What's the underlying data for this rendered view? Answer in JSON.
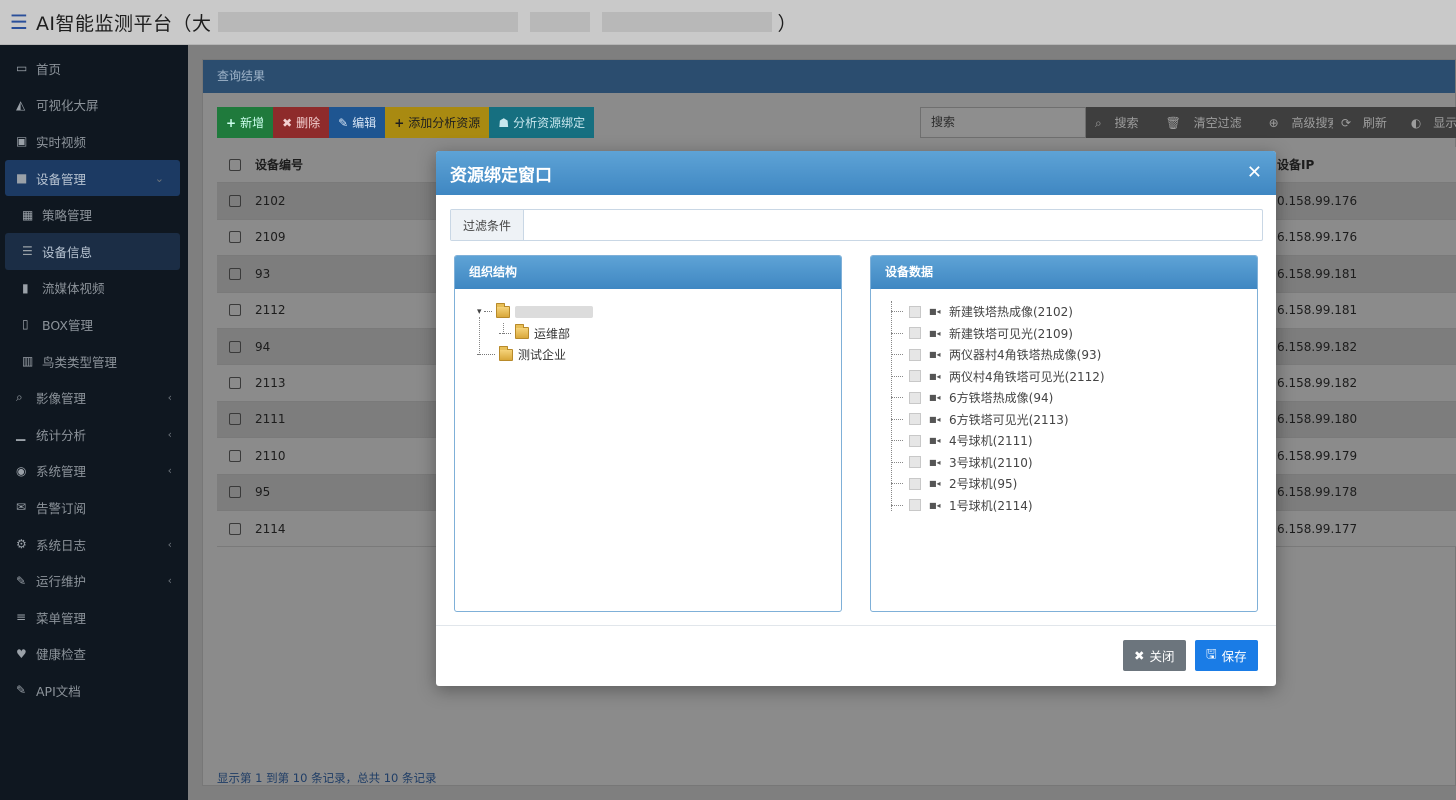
{
  "header": {
    "title": "AI智能监测平台（大",
    "title_suffix": "）"
  },
  "sidebar": {
    "items": [
      {
        "icon": "monitor-icon",
        "glyph": "▭",
        "label": "首页"
      },
      {
        "icon": "area-chart-icon",
        "glyph": "◭",
        "label": "可视化大屏"
      },
      {
        "icon": "film-icon",
        "glyph": "▣",
        "label": "实时视频"
      },
      {
        "icon": "video-camera-icon",
        "glyph": "■",
        "label": "设备管理",
        "caret": "⌄"
      },
      {
        "icon": "grid-icon",
        "glyph": "▦",
        "label": "策略管理"
      },
      {
        "icon": "list-icon",
        "glyph": "☰",
        "label": "设备信息"
      },
      {
        "icon": "stream-icon",
        "glyph": "▮",
        "label": "流媒体视频"
      },
      {
        "icon": "box-icon",
        "glyph": "▯",
        "label": "BOX管理"
      },
      {
        "icon": "building-icon",
        "glyph": "▥",
        "label": "鸟类类型管理"
      },
      {
        "icon": "search-icon",
        "glyph": "⌕",
        "label": "影像管理",
        "caret": "‹"
      },
      {
        "icon": "bar-chart-icon",
        "glyph": "▁",
        "label": "统计分析",
        "caret": "‹"
      },
      {
        "icon": "user-circle-icon",
        "glyph": "◉",
        "label": "系统管理",
        "caret": "‹"
      },
      {
        "icon": "envelope-icon",
        "glyph": "✉",
        "label": "告警订阅"
      },
      {
        "icon": "cogs-icon",
        "glyph": "⚙",
        "label": "系统日志",
        "caret": "‹"
      },
      {
        "icon": "wrench-icon",
        "glyph": "✎",
        "label": "运行维护",
        "caret": "‹"
      },
      {
        "icon": "menu-icon",
        "glyph": "≡",
        "label": "菜单管理"
      },
      {
        "icon": "heartbeat-icon",
        "glyph": "♥",
        "label": "健康检查"
      },
      {
        "icon": "wrench-icon",
        "glyph": "✎",
        "label": "API文档"
      }
    ]
  },
  "panel": {
    "title": "查询结果",
    "toolbar": {
      "add": "新增",
      "delete": "删除",
      "edit": "编辑",
      "add_resource": "添加分析资源",
      "bind_resource": "分析资源绑定"
    },
    "search_placeholder": "搜索",
    "search_label": "搜索",
    "clear_filter": "清空过滤",
    "advanced_search": "高级搜索",
    "refresh": "刷新",
    "show": "显示"
  },
  "table": {
    "col_no": "设备编号",
    "col_ip": "设备IP",
    "rows": [
      {
        "no": "2102",
        "ip": "0.158.99.176"
      },
      {
        "no": "2109",
        "ip": "6.158.99.176"
      },
      {
        "no": "93",
        "ip": "6.158.99.181"
      },
      {
        "no": "2112",
        "ip": "6.158.99.181"
      },
      {
        "no": "94",
        "ip": "6.158.99.182"
      },
      {
        "no": "2113",
        "ip": "6.158.99.182"
      },
      {
        "no": "2111",
        "ip": "6.158.99.180"
      },
      {
        "no": "2110",
        "ip": "6.158.99.179"
      },
      {
        "no": "95",
        "ip": "6.158.99.178"
      },
      {
        "no": "2114",
        "ip": "6.158.99.177"
      }
    ],
    "footer": "显示第 1 到第 10 条记录，总共 10 条记录"
  },
  "modal": {
    "title": "资源绑定窗口",
    "filter_label": "过滤条件",
    "org_title": "组织结构",
    "dev_title": "设备数据",
    "org_tree": {
      "root_label": "",
      "child": "运维部",
      "second": "测试企业"
    },
    "devices": [
      "新建铁塔热成像(2102)",
      "新建铁塔可见光(2109)",
      "两仪器村4角铁塔热成像(93)",
      "两仪村4角铁塔可见光(2112)",
      "6方铁塔热成像(94)",
      "6方铁塔可见光(2113)",
      "4号球机(2111)",
      "3号球机(2110)",
      "2号球机(95)",
      "1号球机(2114)"
    ],
    "close_btn": "关闭",
    "save_btn": "保存"
  }
}
